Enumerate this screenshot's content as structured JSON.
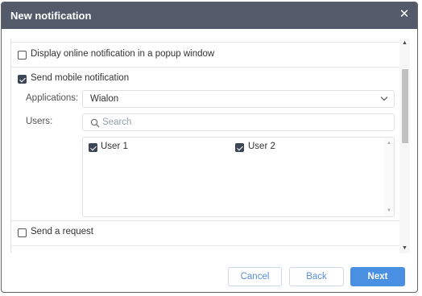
{
  "dialog": {
    "title": "New notification",
    "close_icon": "close-icon"
  },
  "options": {
    "popup_label": "Display online notification in a popup window",
    "popup_checked": false,
    "mobile_label": "Send mobile notification",
    "mobile_checked": true,
    "request_label": "Send a request",
    "request_checked": false
  },
  "mobile": {
    "applications_label": "Applications:",
    "applications_value": "Wialon",
    "users_label": "Users:",
    "search_placeholder": "Search",
    "users": [
      {
        "name": "User 1",
        "checked": true
      },
      {
        "name": "User 2",
        "checked": true
      }
    ]
  },
  "footer": {
    "cancel_label": "Cancel",
    "back_label": "Back",
    "next_label": "Next"
  },
  "colors": {
    "titlebar": "#535a69",
    "primary": "#4a90e2",
    "checkbox": "#3d4657"
  }
}
